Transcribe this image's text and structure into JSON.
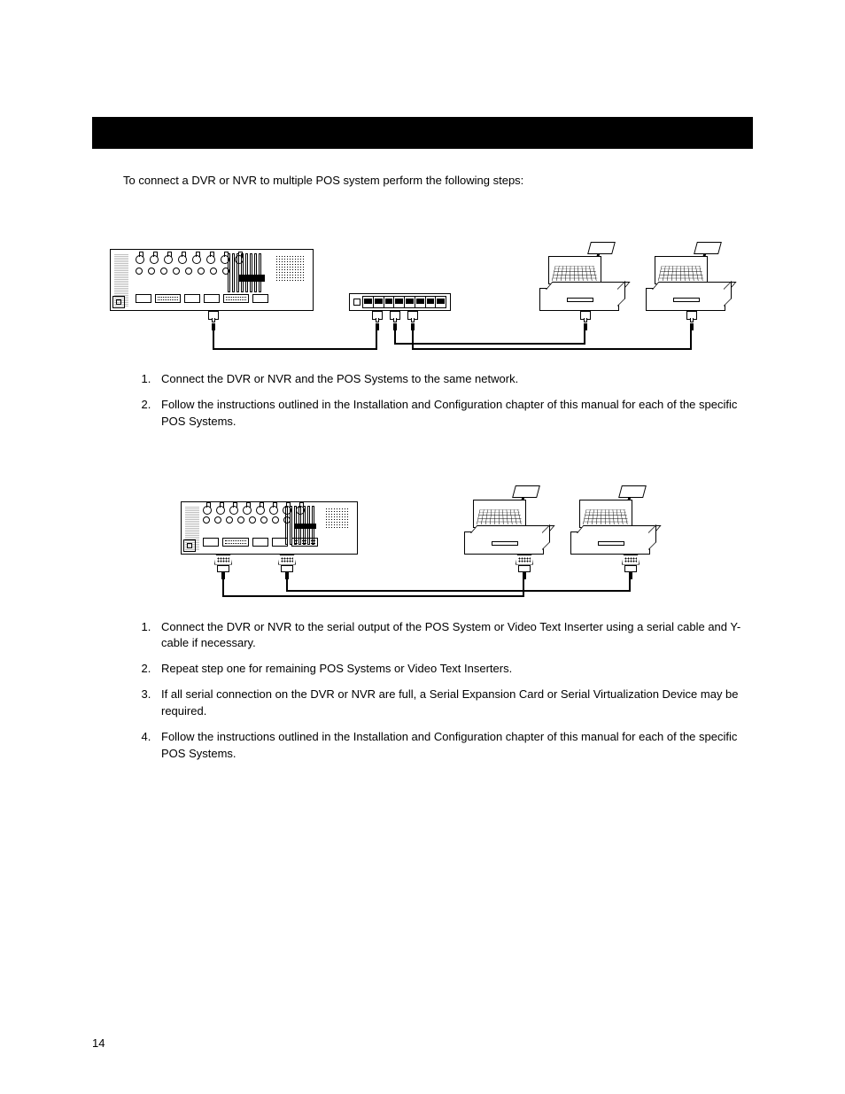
{
  "intro": "To connect a DVR or NVR to multiple POS system perform the following steps:",
  "section1": {
    "steps": [
      "Connect the DVR or NVR and the POS Systems to the same network.",
      "Follow the instructions outlined in the Installation and Configuration chapter of this manual for each of the specific POS Systems."
    ]
  },
  "section2": {
    "steps": [
      "Connect the DVR or NVR to the serial output of the POS System or Video Text Inserter using a serial cable and Y-cable if necessary.",
      "Repeat step one for remaining POS Systems or Video Text Inserters.",
      "If all serial connection on the DVR or NVR are full, a Serial Expansion Card or Serial Virtualization Device may be required.",
      "Follow the instructions outlined in the Installation and Configuration chapter of this manual for each of the specific POS Systems."
    ]
  },
  "pageNumber": "14"
}
